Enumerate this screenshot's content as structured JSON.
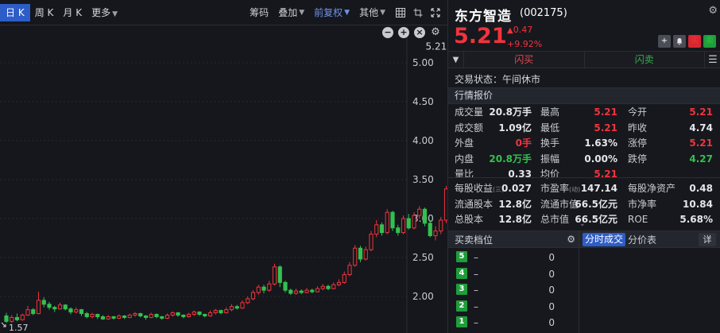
{
  "toolbar": {
    "periods": [
      "日 K",
      "周 K",
      "月 K",
      "更多"
    ],
    "chip": "筹码",
    "overlay": "叠加",
    "adjust": "前复权",
    "other": "其他"
  },
  "chart_data": {
    "type": "candlestick",
    "y_ticks": [
      "5.00",
      "4.50",
      "4.00",
      "3.50",
      "3.00",
      "2.50",
      "2.00"
    ],
    "y_tick_values": [
      5.0,
      4.5,
      4.0,
      3.5,
      3.0,
      2.5,
      2.0
    ],
    "high_label": "5.21",
    "low_label": "1.57",
    "candles": [
      [
        1.75,
        1.68,
        1.79,
        1.66
      ],
      [
        1.68,
        1.73,
        1.76,
        1.66
      ],
      [
        1.73,
        1.7,
        1.78,
        1.68
      ],
      [
        1.7,
        1.76,
        1.78,
        1.69
      ],
      [
        1.76,
        1.83,
        1.88,
        1.75
      ],
      [
        1.83,
        1.78,
        1.85,
        1.76
      ],
      [
        1.78,
        1.95,
        2.06,
        1.77
      ],
      [
        1.95,
        1.9,
        1.99,
        1.86
      ],
      [
        1.9,
        1.86,
        1.93,
        1.83
      ],
      [
        1.86,
        1.84,
        1.88,
        1.8
      ],
      [
        1.84,
        1.89,
        1.92,
        1.83
      ],
      [
        1.89,
        1.84,
        1.9,
        1.82
      ],
      [
        1.84,
        1.8,
        1.86,
        1.77
      ],
      [
        1.8,
        1.83,
        1.86,
        1.78
      ],
      [
        1.83,
        1.78,
        1.84,
        1.75
      ],
      [
        1.78,
        1.74,
        1.8,
        1.72
      ],
      [
        1.74,
        1.77,
        1.79,
        1.72
      ],
      [
        1.77,
        1.74,
        1.78,
        1.71
      ],
      [
        1.74,
        1.71,
        1.76,
        1.7
      ],
      [
        1.71,
        1.74,
        1.76,
        1.7
      ],
      [
        1.74,
        1.72,
        1.75,
        1.7
      ],
      [
        1.72,
        1.75,
        1.77,
        1.71
      ],
      [
        1.75,
        1.73,
        1.76,
        1.71
      ],
      [
        1.73,
        1.76,
        1.78,
        1.72
      ],
      [
        1.76,
        1.78,
        1.8,
        1.74
      ],
      [
        1.78,
        1.75,
        1.79,
        1.73
      ],
      [
        1.75,
        1.73,
        1.76,
        1.7
      ],
      [
        1.73,
        1.77,
        1.79,
        1.72
      ],
      [
        1.77,
        1.74,
        1.78,
        1.72
      ],
      [
        1.74,
        1.72,
        1.75,
        1.7
      ],
      [
        1.72,
        1.76,
        1.78,
        1.71
      ],
      [
        1.76,
        1.79,
        1.81,
        1.74
      ],
      [
        1.79,
        1.76,
        1.8,
        1.74
      ],
      [
        1.76,
        1.74,
        1.77,
        1.72
      ],
      [
        1.74,
        1.77,
        1.79,
        1.73
      ],
      [
        1.77,
        1.8,
        1.82,
        1.75
      ],
      [
        1.8,
        1.77,
        1.81,
        1.75
      ],
      [
        1.77,
        1.75,
        1.78,
        1.73
      ],
      [
        1.75,
        1.79,
        1.82,
        1.74
      ],
      [
        1.79,
        1.82,
        1.84,
        1.77
      ],
      [
        1.82,
        1.79,
        1.83,
        1.77
      ],
      [
        1.79,
        1.83,
        1.86,
        1.78
      ],
      [
        1.83,
        1.87,
        1.9,
        1.81
      ],
      [
        1.87,
        1.85,
        1.89,
        1.83
      ],
      [
        1.85,
        1.92,
        1.95,
        1.84
      ],
      [
        1.92,
        1.97,
        2.0,
        1.9
      ],
      [
        1.97,
        2.05,
        2.08,
        1.95
      ],
      [
        2.05,
        2.12,
        2.15,
        2.02
      ],
      [
        2.12,
        2.08,
        2.15,
        2.04
      ],
      [
        2.08,
        2.16,
        2.2,
        2.06
      ],
      [
        2.16,
        2.38,
        2.42,
        2.14
      ],
      [
        2.38,
        2.18,
        2.4,
        2.12
      ],
      [
        2.18,
        2.08,
        2.2,
        2.05
      ],
      [
        2.08,
        2.04,
        2.1,
        2.02
      ],
      [
        2.04,
        2.07,
        2.1,
        2.02
      ],
      [
        2.07,
        2.05,
        2.09,
        2.03
      ],
      [
        2.05,
        2.08,
        2.11,
        2.04
      ],
      [
        2.08,
        2.06,
        2.1,
        2.04
      ],
      [
        2.06,
        2.1,
        2.13,
        2.05
      ],
      [
        2.1,
        2.13,
        2.16,
        2.08
      ],
      [
        2.13,
        2.1,
        2.15,
        2.08
      ],
      [
        2.1,
        2.15,
        2.18,
        2.09
      ],
      [
        2.15,
        2.18,
        2.22,
        2.13
      ],
      [
        2.18,
        2.28,
        2.32,
        2.16
      ],
      [
        2.28,
        2.4,
        2.44,
        2.26
      ],
      [
        2.4,
        2.62,
        2.66,
        2.38
      ],
      [
        2.62,
        2.48,
        2.65,
        2.44
      ],
      [
        2.48,
        2.6,
        2.64,
        2.46
      ],
      [
        2.6,
        2.8,
        2.84,
        2.58
      ],
      [
        2.8,
        2.92,
        2.98,
        2.76
      ],
      [
        2.92,
        2.82,
        2.95,
        2.78
      ],
      [
        2.82,
        3.08,
        3.12,
        2.8
      ],
      [
        3.08,
        2.88,
        3.1,
        2.84
      ],
      [
        2.88,
        2.82,
        2.92,
        2.78
      ],
      [
        2.82,
        3.0,
        3.04,
        2.8
      ],
      [
        3.0,
        2.88,
        3.06,
        2.86
      ],
      [
        2.88,
        3.04,
        3.08,
        2.86
      ],
      [
        3.04,
        3.12,
        3.16,
        3.0
      ],
      [
        3.12,
        2.94,
        3.14,
        2.9
      ],
      [
        2.94,
        2.78,
        2.98,
        2.76
      ],
      [
        2.78,
        2.84,
        2.9,
        2.72
      ],
      [
        2.84,
        2.98,
        3.02,
        2.8
      ],
      [
        2.98,
        3.38,
        3.42,
        2.94
      ],
      [
        3.38,
        3.72,
        3.74,
        3.36
      ],
      [
        3.72,
        4.09,
        4.12,
        3.7
      ],
      [
        4.26,
        4.5,
        4.94,
        4.22
      ],
      [
        4.5,
        4.73,
        5.21,
        4.46
      ]
    ]
  },
  "stock": {
    "name": "东方智造",
    "code": "(002175)",
    "price": "5.21",
    "change": "0.47",
    "change_arrow": "🠉",
    "pct": "+9.92%",
    "btn_add": "+",
    "btn_bell": "🔔",
    "btn_buy": "买",
    "btn_sell": "卖"
  },
  "tradebar": {
    "flash_buy": "闪买",
    "flash_sell": "闪卖"
  },
  "status": "交易状态：午间休市",
  "quote_title": "行情报价",
  "quote": [
    [
      [
        "成交量",
        "20.8万手",
        ""
      ],
      [
        "最高",
        "5.21",
        "red"
      ],
      [
        "今开",
        "5.21",
        "red"
      ]
    ],
    [
      [
        "成交额",
        "1.09亿",
        ""
      ],
      [
        "最低",
        "5.21",
        "red"
      ],
      [
        "昨收",
        "4.74",
        ""
      ]
    ],
    [
      [
        "外盘",
        "0手",
        "red"
      ],
      [
        "换手",
        "1.63%",
        ""
      ],
      [
        "涨停",
        "5.21",
        "red"
      ]
    ],
    [
      [
        "内盘",
        "20.8万手",
        "green"
      ],
      [
        "振幅",
        "0.00%",
        ""
      ],
      [
        "跌停",
        "4.27",
        "green"
      ]
    ],
    [
      [
        "量比",
        "0.33",
        ""
      ],
      [
        "均价",
        "5.21",
        "red"
      ],
      [
        "",
        "",
        " "
      ]
    ]
  ],
  "quote2": [
    [
      [
        "每股收益",
        "(三)",
        "0.027"
      ],
      [
        "市盈率",
        "(动)",
        "147.14"
      ],
      [
        "每股净资产",
        "",
        "0.48"
      ]
    ],
    [
      [
        "流通股本",
        "",
        "12.8亿"
      ],
      [
        "流通市值",
        "",
        "66.5亿元"
      ],
      [
        "市净率",
        "",
        "10.84"
      ]
    ],
    [
      [
        "总股本",
        "",
        "12.8亿"
      ],
      [
        "总市值",
        "",
        "66.5亿元"
      ],
      [
        "ROE",
        "",
        "5.68%"
      ]
    ]
  ],
  "orderbook": {
    "title": "买卖档位",
    "levels": [
      {
        "n": "5",
        "p": "–",
        "q": "0"
      },
      {
        "n": "4",
        "p": "–",
        "q": "0"
      },
      {
        "n": "3",
        "p": "–",
        "q": "0"
      },
      {
        "n": "2",
        "p": "–",
        "q": "0"
      },
      {
        "n": "1",
        "p": "–",
        "q": "0"
      }
    ]
  },
  "ticks": {
    "tab_ticks": "分时成交",
    "tab_price": "分价表",
    "tab_detail": "详"
  },
  "colors": {
    "up": "#f0343e",
    "down": "#34c04f",
    "accent": "#2d5dc8"
  }
}
